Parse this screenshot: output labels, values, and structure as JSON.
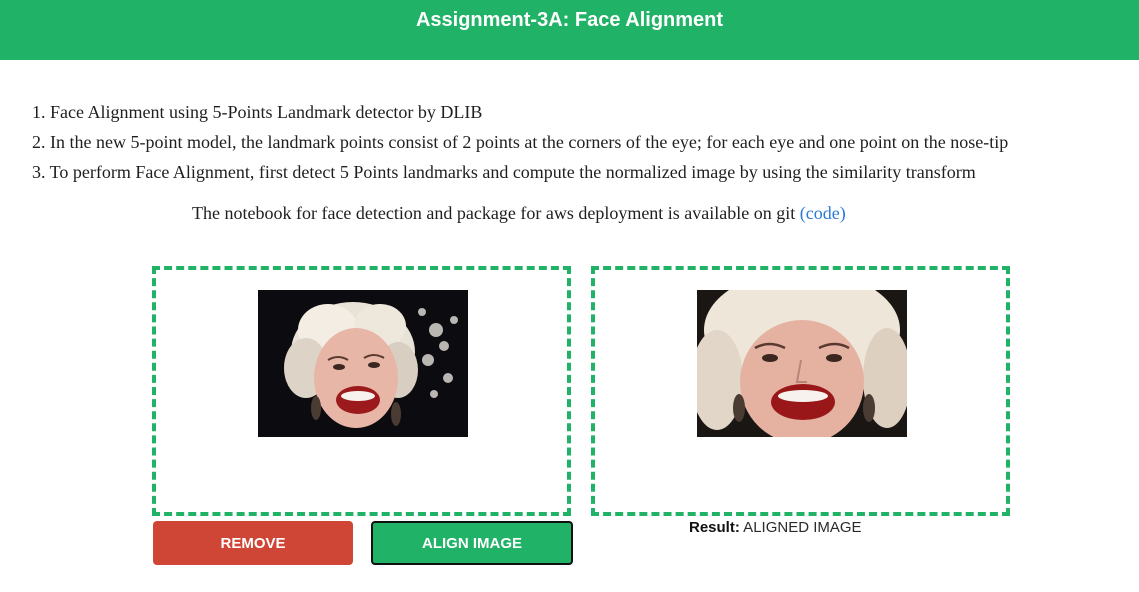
{
  "header": {
    "title": "Assignment-3A: Face Alignment"
  },
  "steps": [
    "1. Face Alignment using 5-Points Landmark detector by DLIB",
    "2. In the new 5-point model, the landmark points consist of 2 points at the corners of the eye; for each eye and one point on the nose-tip",
    "3. To perform Face Alignment, first detect 5 Points landmarks and compute the normalized image by using the similarity transform"
  ],
  "note": {
    "text": "The notebook for face detection and package for aws deployment is available on git ",
    "link_open": "(",
    "link_label": "code",
    "link_close": ")"
  },
  "buttons": {
    "remove": "REMOVE",
    "align": "ALIGN IMAGE"
  },
  "result": {
    "label": "Result:",
    "value": " ALIGNED IMAGE"
  },
  "colors": {
    "accent": "#20b266",
    "danger": "#d04636",
    "link": "#2a7ad6"
  }
}
